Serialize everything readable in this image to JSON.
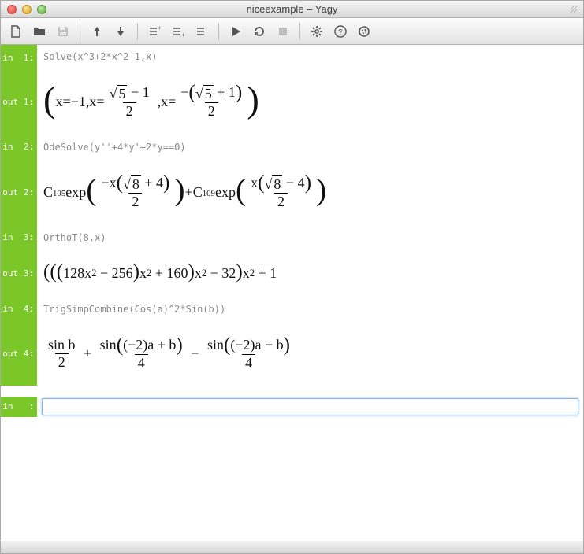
{
  "window": {
    "title": "niceexample – Yagy"
  },
  "toolbar": {
    "new": "new",
    "open": "open",
    "save": "save",
    "up": "up",
    "down": "down",
    "insertAbove": "insert-above",
    "insertBelow": "insert-below",
    "removeCell": "remove-cell",
    "run": "run",
    "reload": "reload",
    "stop": "stop",
    "settings": "settings",
    "help": "help",
    "target": "target"
  },
  "cells": [
    {
      "kind": "in",
      "label": "in  1:",
      "text": "Solve(x^3+2*x^2-1,x)"
    },
    {
      "kind": "out",
      "label": "out 1:",
      "expr_id": "out1"
    },
    {
      "kind": "in",
      "label": "in  2:",
      "text": "OdeSolve(y''+4*y'+2*y==0)"
    },
    {
      "kind": "out",
      "label": "out 2:",
      "expr_id": "out2"
    },
    {
      "kind": "in",
      "label": "in  3:",
      "text": "OrthoT(8,x)"
    },
    {
      "kind": "out",
      "label": "out 3:",
      "expr_id": "out3"
    },
    {
      "kind": "in",
      "label": "in  4:",
      "text": "TrigSimpCombine(Cos(a)^2*Sin(b))"
    },
    {
      "kind": "out",
      "label": "out 4:",
      "expr_id": "out4"
    },
    {
      "kind": "active",
      "label": "in   :",
      "value": ""
    }
  ],
  "math": {
    "out1": {
      "plain": "( x = -1, x = (√5 − 1)/2 , x = −(√5 + 1)/2 )",
      "root5": "5",
      "minus1": "−1",
      "one": "1",
      "two": "2",
      "x": "x",
      "eq": " = ",
      "comma": ","
    },
    "out2": {
      "plain": "C105 exp( −x(√8 + 4)/2 ) + C109 exp( x(√8 − 4)/2 )",
      "C": "C",
      "sub105": "105",
      "sub109": "109",
      "exp": " exp",
      "root8": "8",
      "four": "4",
      "two": "2",
      "x": "x",
      "plus": " + ",
      "minus": " − "
    },
    "out3": {
      "plain": "( ( (128x^2 − 256)x^2 + 160 ) x^2 − 32 ) x^2 + 1",
      "n128": "128",
      "n256": "256",
      "n160": "160",
      "n32": "32",
      "one": "1",
      "x": "x",
      "sq": "2"
    },
    "out4": {
      "plain": "sin b / 2 + sin((−2)a + b)/4 − sin((−2)a − b)/4",
      "sin": "sin",
      "b": "b",
      "two": "2",
      "four": "4",
      "a": "a",
      "neg2": "−2"
    }
  },
  "colors": {
    "gutter": "#7bc628",
    "accent": "#7fb4e8"
  }
}
